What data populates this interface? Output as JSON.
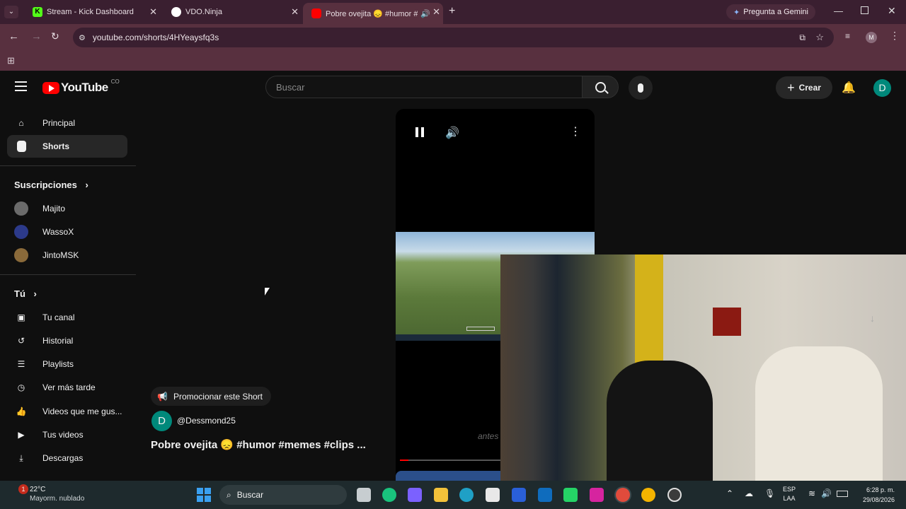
{
  "browser": {
    "tabs": [
      {
        "title": "Stream - Kick Dashboard",
        "active": false,
        "color": "#53fc18"
      },
      {
        "title": "VDO.Ninja",
        "active": false,
        "color": "#ffffff"
      },
      {
        "title": "Pobre ovejita 😞 #humor #",
        "active": true,
        "color": "#ff0000"
      }
    ],
    "gemini_label": "Pregunta a Gemini",
    "url": "youtube.com/shorts/4HYeaysfq3s",
    "profile_initial": "M"
  },
  "youtube": {
    "logo_text": "YouTube",
    "logo_badge": "CO",
    "search_placeholder": "Buscar",
    "create_label": "Crear",
    "avatar_initial": "D",
    "nav": [
      {
        "label": "Principal",
        "icon": "home-icon"
      },
      {
        "label": "Shorts",
        "icon": "shorts-icon",
        "active": true
      }
    ],
    "subscriptions_heading": "Suscripciones",
    "subscriptions": [
      {
        "label": "Majito"
      },
      {
        "label": "WassoX"
      },
      {
        "label": "JintoMSK"
      }
    ],
    "you_heading": "Tú",
    "you_items": [
      {
        "label": "Tu canal",
        "icon": "channel-icon"
      },
      {
        "label": "Historial",
        "icon": "history-icon"
      },
      {
        "label": "Playlists",
        "icon": "playlist-icon"
      },
      {
        "label": "Ver más tarde",
        "icon": "clock-icon"
      },
      {
        "label": "Videos que me gus...",
        "icon": "like-icon"
      },
      {
        "label": "Tus videos",
        "icon": "video-icon"
      },
      {
        "label": "Descargas",
        "icon": "download-icon"
      }
    ],
    "short": {
      "promote_label": "Promocionar este Short",
      "channel_initial": "D",
      "channel_handle": "@Dessmond25",
      "title": "Pobre ovejita 😞 #humor #memes #clips ...",
      "overlay_text": "antes"
    }
  },
  "taskbar": {
    "weather_temp": "22°C",
    "weather_desc": "Mayorm. nublado",
    "weather_badge": "1",
    "search_label": "Buscar",
    "lang_top": "ESP",
    "lang_bottom": "LAA",
    "time": "6:28 p. m.",
    "date": "29/08/2026"
  }
}
